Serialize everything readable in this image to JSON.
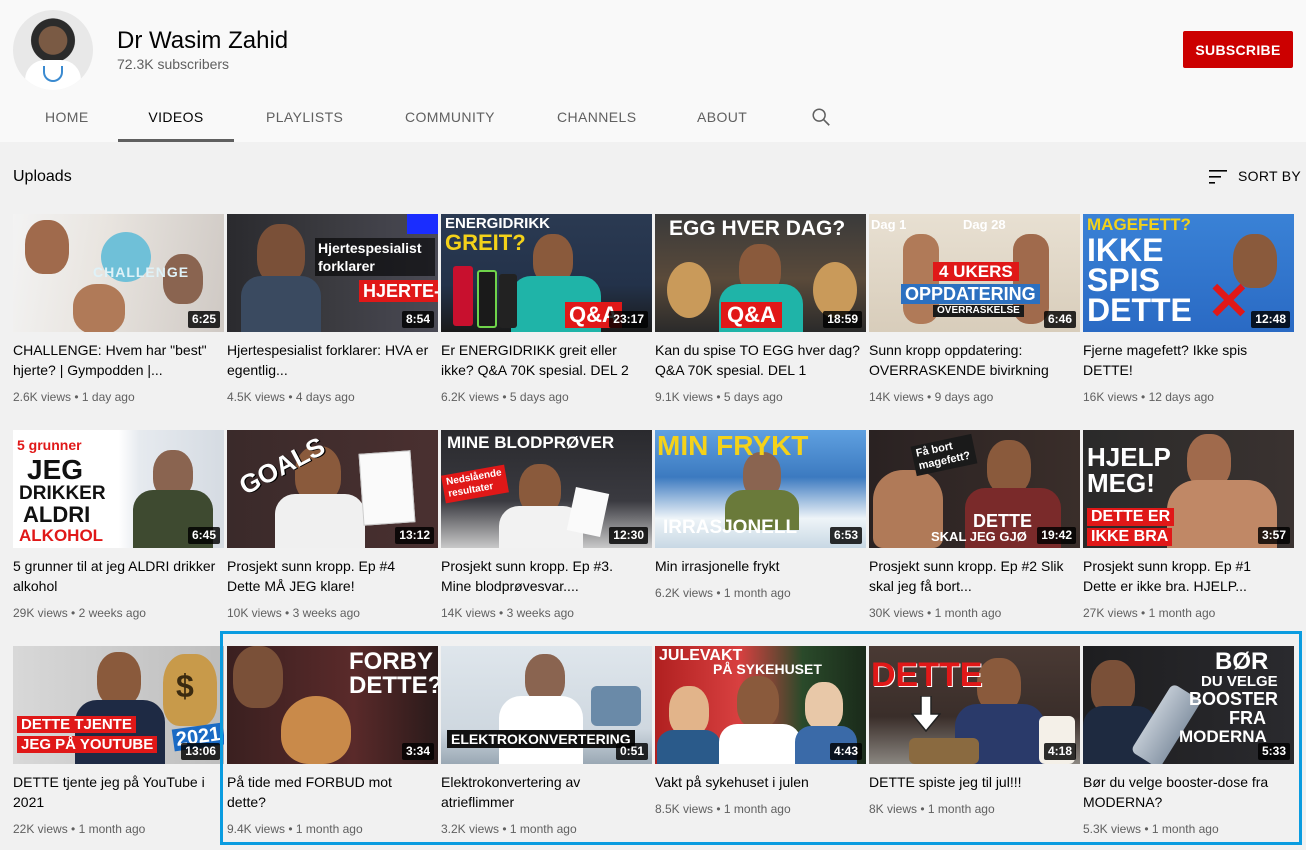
{
  "channel": {
    "name": "Dr Wasim Zahid",
    "subscribers": "72.3K subscribers",
    "subscribe_label": "SUBSCRIBE"
  },
  "tabs": [
    "HOME",
    "VIDEOS",
    "PLAYLISTS",
    "COMMUNITY",
    "CHANNELS",
    "ABOUT"
  ],
  "active_tab": "VIDEOS",
  "section": {
    "title": "Uploads",
    "sort_label": "SORT BY"
  },
  "videos": [
    {
      "title": "CHALLENGE: Hvem har \"best\" hjerte? | Gympodden |...",
      "views": "2.6K views",
      "age": "1 day ago",
      "duration": "6:25",
      "thumb_text": "CHALLENGE"
    },
    {
      "title": "Hjertespesialist forklarer: HVA er egentlig...",
      "views": "4.5K views",
      "age": "4 days ago",
      "duration": "8:54",
      "thumb_text": "Hjertespesialist forklarer",
      "thumb_text2": "HJERTE-BAN"
    },
    {
      "title": "Er ENERGIDRIKK greit eller ikke? Q&A 70K spesial. DEL 2",
      "views": "6.2K views",
      "age": "5 days ago",
      "duration": "23:17",
      "thumb_text": "ENERGIDRIKK",
      "thumb_text2": "GREIT?",
      "thumb_text3": "Q&A"
    },
    {
      "title": "Kan du spise TO EGG hver dag? Q&A 70K spesial. DEL 1",
      "views": "9.1K views",
      "age": "5 days ago",
      "duration": "18:59",
      "thumb_text": "EGG HVER DAG?",
      "thumb_text2": "Q&A"
    },
    {
      "title": "Sunn kropp oppdatering: OVERRASKENDE bivirkning",
      "views": "14K views",
      "age": "9 days ago",
      "duration": "6:46",
      "thumb_text": "Dag 1",
      "thumb_text2": "Dag 28",
      "thumb_text3": "4 UKERS",
      "thumb_text4": "OPPDATERING",
      "thumb_text5": "OVERRASKELSE"
    },
    {
      "title": "Fjerne magefett? Ikke spis DETTE!",
      "views": "16K views",
      "age": "12 days ago",
      "duration": "12:48",
      "thumb_text": "MAGEFETT?",
      "thumb_text2": "IKKE",
      "thumb_text3": "SPIS",
      "thumb_text4": "DETTE"
    },
    {
      "title": "5 grunner til at jeg ALDRI drikker alkohol",
      "views": "29K views",
      "age": "2 weeks ago",
      "duration": "6:45",
      "thumb_text": "5 grunner",
      "thumb_text2": "JEG",
      "thumb_text3": "DRIKKER",
      "thumb_text4": "ALDRI",
      "thumb_text5": "ALKOHOL"
    },
    {
      "title": "Prosjekt sunn kropp. Ep #4 Dette MÅ JEG klare!",
      "views": "10K views",
      "age": "3 weeks ago",
      "duration": "13:12",
      "thumb_text": "GOALS"
    },
    {
      "title": "Prosjekt sunn kropp. Ep #3. Mine blodprøvesvar....",
      "views": "14K views",
      "age": "3 weeks ago",
      "duration": "12:30",
      "thumb_text": "MINE BLODPRØVER",
      "thumb_text2": "Nedslående resultater"
    },
    {
      "title": "Min irrasjonelle frykt",
      "views": "6.2K views",
      "age": "1 month ago",
      "duration": "6:53",
      "thumb_text": "MIN FRYKT",
      "thumb_text2": "IRRASJONELL"
    },
    {
      "title": "Prosjekt sunn kropp. Ep #2 Slik skal jeg få bort...",
      "views": "30K views",
      "age": "1 month ago",
      "duration": "19:42",
      "thumb_text": "Få bort magefett?",
      "thumb_text2": "DETTE",
      "thumb_text3": "SKAL JEG GJØ"
    },
    {
      "title": "Prosjekt sunn kropp. Ep #1 Dette er ikke bra. HJELP...",
      "views": "27K views",
      "age": "1 month ago",
      "duration": "3:57",
      "thumb_text": "HJELP",
      "thumb_text2": "MEG!",
      "thumb_text3": "DETTE ER",
      "thumb_text4": "IKKE BRA"
    },
    {
      "title": "DETTE tjente jeg på YouTube i 2021",
      "views": "22K views",
      "age": "1 month ago",
      "duration": "13:06",
      "thumb_text": "DETTE TJENTE",
      "thumb_text2": "JEG PÅ YOUTUBE",
      "thumb_text3": "2021"
    },
    {
      "title": "På tide med FORBUD mot dette?",
      "views": "9.4K views",
      "age": "1 month ago",
      "duration": "3:34",
      "thumb_text": "FORBY",
      "thumb_text2": "DETTE?"
    },
    {
      "title": "Elektrokonvertering av atrieflimmer",
      "views": "3.2K views",
      "age": "1 month ago",
      "duration": "0:51",
      "thumb_text": "ELEKTROKONVERTERING"
    },
    {
      "title": "Vakt på sykehuset i julen",
      "views": "8.5K views",
      "age": "1 month ago",
      "duration": "4:43",
      "thumb_text": "JULEVAKT",
      "thumb_text2": "PÅ SYKEHUSET"
    },
    {
      "title": "DETTE spiste jeg til jul!!!",
      "views": "8K views",
      "age": "1 month ago",
      "duration": "4:18",
      "thumb_text": "DETTE"
    },
    {
      "title": "Bør du velge booster-dose fra MODERNA?",
      "views": "5.3K views",
      "age": "1 month ago",
      "duration": "5:33",
      "thumb_text": "BØR",
      "thumb_text2": "DU VELGE",
      "thumb_text3": "BOOSTER",
      "thumb_text4": "FRA",
      "thumb_text5": "MODERNA"
    }
  ]
}
